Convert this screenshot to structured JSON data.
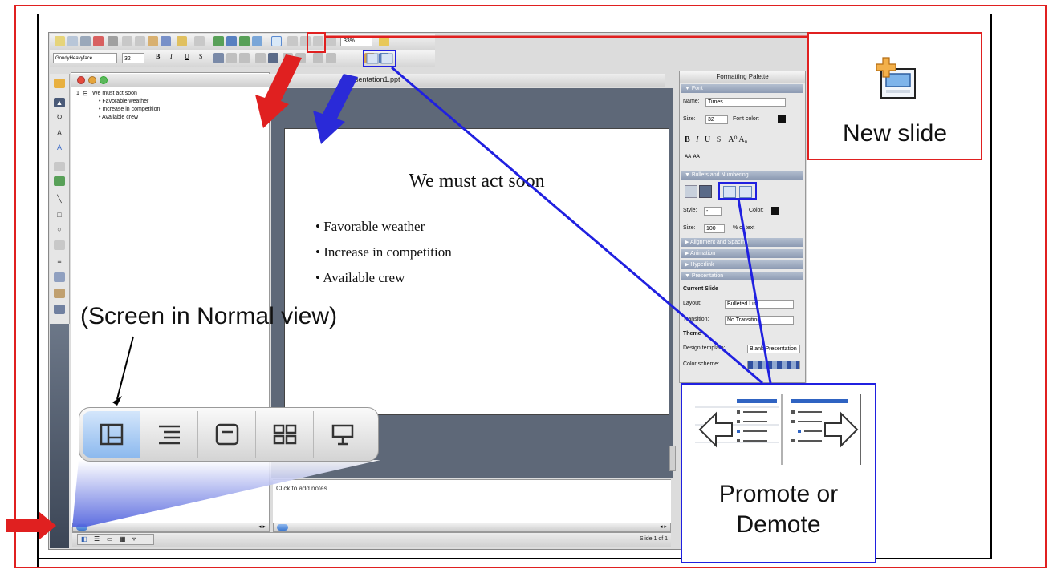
{
  "outline": {
    "slide_number": "1",
    "title": "We must act soon",
    "bullets": [
      "Favorable weather",
      "Increase in competition",
      "Available crew"
    ]
  },
  "toolbar": {
    "font_name": "GoudyHeavyface",
    "font_size": "32",
    "format_buttons": [
      "B",
      "I",
      "U",
      "S"
    ],
    "zoom": "33%"
  },
  "window": {
    "title": "Presentation1.ppt"
  },
  "slide": {
    "title": "We must act soon",
    "bullets": [
      "Favorable weather",
      "Increase in competition",
      "Available crew"
    ]
  },
  "notes": {
    "placeholder": "Click to add notes"
  },
  "status": {
    "slide_count": "Slide 1 of 1"
  },
  "palette": {
    "title": "Formatting Palette",
    "font_section": "Font",
    "name_label": "Name:",
    "name_value": "Times",
    "size_label": "Size:",
    "size_value": "32",
    "font_color_label": "Font color:",
    "bullets_section": "Bullets and Numbering",
    "style_label": "Style:",
    "style_value": "-",
    "color_label": "Color:",
    "bullet_size_label": "Size:",
    "bullet_size_value": "100",
    "of_text_label": "% of text",
    "alignment_section": "Alignment and Spacing",
    "animation_section": "Animation",
    "hyperlink_section": "Hyperlink",
    "presentation_section": "Presentation",
    "current_slide_label": "Current Slide",
    "layout_label": "Layout:",
    "layout_value": "Bulleted List",
    "transition_label": "Transition:",
    "transition_value": "No Transition",
    "theme_label": "Theme",
    "design_template_label": "Design template:",
    "design_template_value": "Blank Presentation",
    "color_scheme_label": "Color scheme:"
  },
  "callouts": {
    "new_slide": "New slide",
    "promote_line1": "Promote or",
    "promote_line2": "Demote",
    "normal_view": "(Screen in Normal view)"
  },
  "icons": {
    "new_slide": "new-slide-icon",
    "promote": "promote-icon",
    "demote": "demote-icon",
    "normal_view": "normal-view-icon",
    "outline_view": "outline-view-icon",
    "slide_view": "slide-view-icon",
    "slide_sorter": "slide-sorter-icon",
    "slide_show": "slide-show-icon"
  },
  "colors": {
    "callout_red": "#e02020",
    "callout_blue": "#2020e0",
    "slide_background_area": "#5e6878",
    "active_view": "#8cb9ee"
  }
}
